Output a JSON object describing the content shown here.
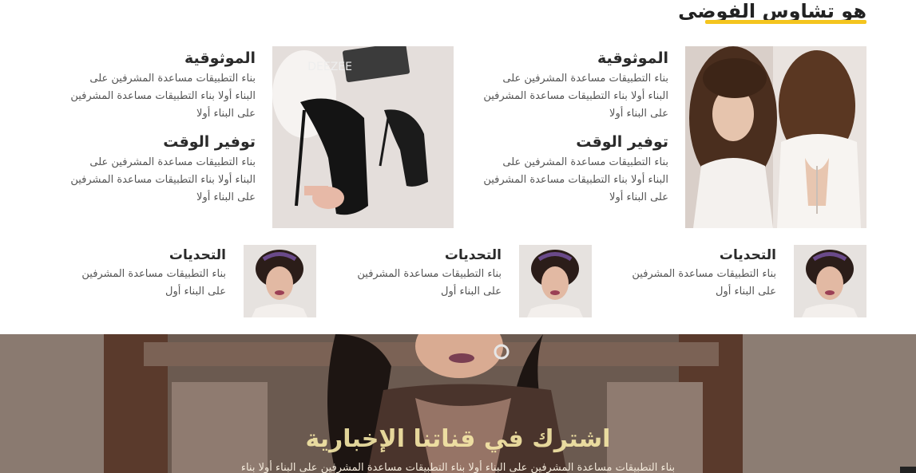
{
  "section": {
    "title": "هو تشاوس الفوضى"
  },
  "big_cards": [
    {
      "heading1": "الموثوقية",
      "body1": "بناء التطبيقات مساعدة المشرفين على البناء أولا بناء التطبيقات مساعدة المشرفين على البناء أولا",
      "heading2": "توفير الوقت",
      "body2": "بناء التطبيقات مساعدة المشرفين على البناء أولا بناء التطبيقات مساعدة المشرفين على البناء أولا",
      "image": "bride-hairstyle-photo"
    },
    {
      "heading1": "الموثوقية",
      "body1": "بناء التطبيقات مساعدة المشرفين على البناء أولا بناء التطبيقات مساعدة المشرفين على البناء أولا",
      "heading2": "توفير الوقت",
      "body2": "بناء التطبيقات مساعدة المشرفين على البناء أولا بناء التطبيقات مساعدة المشرفين على البناء أولا",
      "image": "black-heels-photo",
      "brand": "DEEZEE"
    }
  ],
  "small_cards": [
    {
      "heading": "التحديات",
      "body": "بناء التطبيقات مساعدة المشرفين على البناء أول",
      "image": "bride-crown-photo"
    },
    {
      "heading": "التحديات",
      "body": "بناء التطبيقات مساعدة المشرفين على البناء أول",
      "image": "bride-crown-photo"
    },
    {
      "heading": "التحديات",
      "body": "بناء التطبيقات مساعدة المشرفين على البناء أول",
      "image": "bride-crown-photo"
    }
  ],
  "banner": {
    "title": "اشترك في قناتنا الإخبارية",
    "subtitle": "بناء التطبيقات مساعدة المشرفين على البناء أولا بناء التطبيقات مساعدة المشرفين على البناء أولا بناء"
  },
  "colors": {
    "accent": "#f4c51f",
    "heading": "#2a2a2a",
    "body": "#555555"
  }
}
